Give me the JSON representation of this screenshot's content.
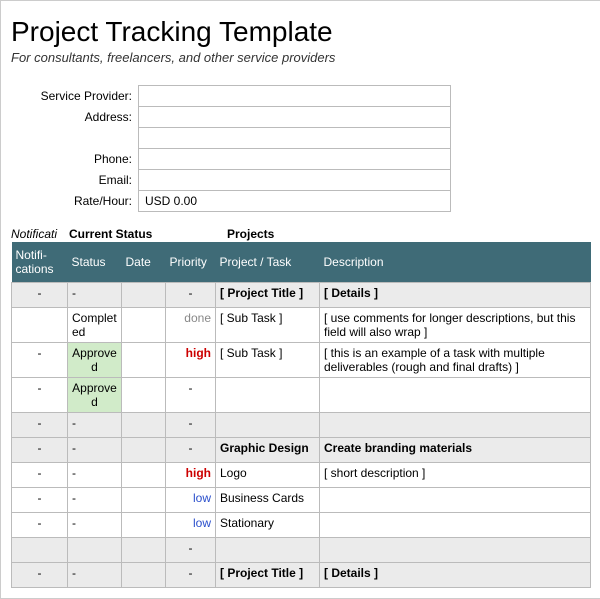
{
  "header": {
    "title": "Project Tracking Template",
    "subtitle": "For consultants, freelancers, and other service providers"
  },
  "info": {
    "labels": {
      "provider": "Service Provider:",
      "address": "Address:",
      "phone": "Phone:",
      "email": "Email:",
      "rate": "Rate/Hour:"
    },
    "values": {
      "provider": "",
      "address1": "",
      "address2": "",
      "phone": "",
      "email": "",
      "rate": "USD 0.00"
    }
  },
  "sections": {
    "notif": "Notificati",
    "status": "Current Status",
    "projects": "Projects"
  },
  "columns": {
    "notif": "Notifi-cations",
    "status": "Status",
    "date": "Date",
    "priority": "Priority",
    "task": "Project / Task",
    "desc": "Description"
  },
  "rows": [
    {
      "shade": true,
      "bold": true,
      "notif": "-",
      "status": "-",
      "date": "",
      "prio": "-",
      "prioClass": "c",
      "task": "[ Project Title ]",
      "desc": "[ Details ]"
    },
    {
      "notif": "",
      "status": "Completed",
      "date": "",
      "prio": "done",
      "prioClass": "prio-done",
      "task": "[ Sub Task ]",
      "desc": "[ use comments for longer descriptions, but this field will also wrap ]"
    },
    {
      "notif": "-",
      "status": "Approved",
      "statusClass": "approved",
      "date": "",
      "prio": "high",
      "prioClass": "prio-high",
      "task": "[ Sub Task ]",
      "desc": "[ this is an example of a task with multiple deliverables (rough and final drafts) ]"
    },
    {
      "notif": "-",
      "status": "Approved",
      "statusClass": "approved",
      "date": "",
      "prio": "-",
      "prioClass": "c",
      "task": "",
      "desc": ""
    },
    {
      "shade": true,
      "notif": "-",
      "status": "-",
      "date": "",
      "prio": "-",
      "prioClass": "c",
      "task": "",
      "desc": ""
    },
    {
      "shade": true,
      "bold": true,
      "notif": "-",
      "status": "-",
      "date": "",
      "prio": "-",
      "prioClass": "c",
      "task": "Graphic Design",
      "desc": "Create branding materials"
    },
    {
      "notif": "-",
      "status": "-",
      "date": "",
      "prio": "high",
      "prioClass": "prio-high",
      "task": "Logo",
      "desc": "[ short description ]"
    },
    {
      "notif": "-",
      "status": "-",
      "date": "",
      "prio": "low",
      "prioClass": "prio-low",
      "task": "Business Cards",
      "desc": ""
    },
    {
      "notif": "-",
      "status": "-",
      "date": "",
      "prio": "low",
      "prioClass": "prio-low",
      "task": "Stationary",
      "desc": ""
    },
    {
      "shade": true,
      "notif": "",
      "status": "",
      "date": "",
      "prio": "-",
      "prioClass": "c",
      "task": "",
      "desc": ""
    },
    {
      "shade": true,
      "bold": true,
      "notif": "-",
      "status": "-",
      "date": "",
      "prio": "-",
      "prioClass": "c",
      "task": "[ Project Title ]",
      "desc": "[ Details ]"
    }
  ]
}
